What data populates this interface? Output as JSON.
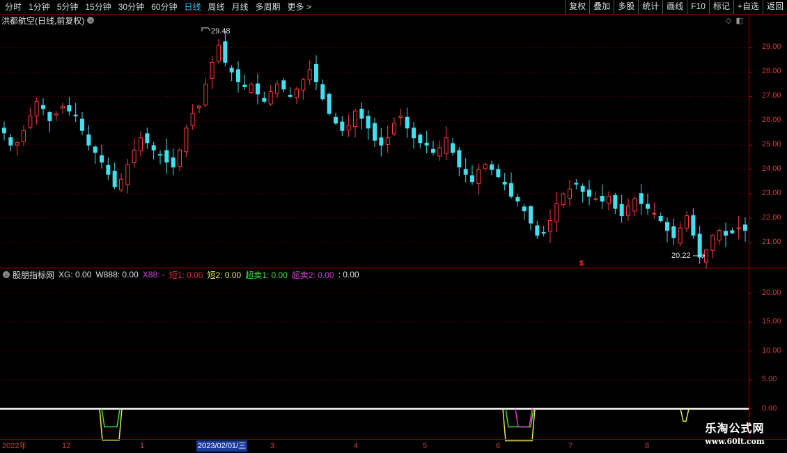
{
  "toolbar": {
    "periods": [
      "分时",
      "1分钟",
      "5分钟",
      "15分钟",
      "30分钟",
      "60分钟",
      "日线",
      "周线",
      "月线",
      "多周期",
      "更多 >"
    ],
    "active_period": "日线",
    "buttons": [
      "复权",
      "叠加",
      "多股",
      "统计",
      "画线",
      "F10",
      "标记",
      "+自选",
      "返回"
    ]
  },
  "chart_title": {
    "name": "洪都航空(日线,前复权)",
    "icon": "chevron-down-icon"
  },
  "price_axis": [
    "29.00",
    "28.00",
    "27.00",
    "26.00",
    "25.00",
    "24.00",
    "23.00",
    "22.00",
    "21.00"
  ],
  "annotations": {
    "high": "29.48",
    "low": "20.22",
    "marker": "$"
  },
  "indicator": {
    "name": "股朋指标网",
    "items": [
      {
        "label": "XG: 0.00",
        "color": "#e0e0e0"
      },
      {
        "label": "W888: 0.00",
        "color": "#e0e0e0"
      },
      {
        "label": "X88: -",
        "color": "#d040d0"
      },
      {
        "label": "短1: 0.00",
        "color": "#e03030"
      },
      {
        "label": "短2: 0.00",
        "color": "#e8e860"
      },
      {
        "label": "超卖1: 0.00",
        "color": "#40e040"
      },
      {
        "label": "超卖2: 0.00",
        "color": "#d040d0"
      },
      {
        "label": ": 0.00",
        "color": "#e0e0e0"
      }
    ]
  },
  "indicator_axis": [
    "20.00",
    "15.00",
    "10.00",
    "5.00",
    "0.00"
  ],
  "dates": [
    "2022年",
    "12",
    "1",
    "2023/02/01/三",
    "3",
    "4",
    "5",
    "6",
    "7",
    "8"
  ],
  "watermark": {
    "title": "乐淘公式网",
    "url": "www.60lt.com"
  },
  "colors": {
    "up": "#ff3c3c",
    "down": "#40e0f0",
    "grid": "#7a0000",
    "text_red": "#d04040"
  },
  "chart_data": {
    "type": "candlestick",
    "title": "洪都航空(日线,前复权)",
    "ylim": [
      20.0,
      29.9
    ],
    "high": 29.48,
    "low": 20.22,
    "closes": [
      25.5,
      25.0,
      25.1,
      25.6,
      26.2,
      26.8,
      26.5,
      26.0,
      26.3,
      26.6,
      26.4,
      26.2,
      25.6,
      25.0,
      24.7,
      24.3,
      23.8,
      23.3,
      23.6,
      24.2,
      24.8,
      25.3,
      25.1,
      24.8,
      24.6,
      24.3,
      24.1,
      24.8,
      25.7,
      26.3,
      26.6,
      27.5,
      28.4,
      29.1,
      28.4,
      28.0,
      27.6,
      27.4,
      27.5,
      27.1,
      26.8,
      27.2,
      27.5,
      27.3,
      27.0,
      27.3,
      27.7,
      28.1,
      27.6,
      26.9,
      26.3,
      25.9,
      25.6,
      25.8,
      26.4,
      26.1,
      25.7,
      25.2,
      25.0,
      25.3,
      25.9,
      26.2,
      25.7,
      25.3,
      25.1,
      25.0,
      24.7,
      24.9,
      25.3,
      24.7,
      24.1,
      23.8,
      23.5,
      24.0,
      24.2,
      24.0,
      23.7,
      23.4,
      22.9,
      22.7,
      22.3,
      21.8,
      21.3,
      21.4,
      21.9,
      22.6,
      23.0,
      23.2,
      23.4,
      23.1,
      22.9,
      22.8,
      22.7,
      22.9,
      22.4,
      22.1,
      22.5,
      22.8,
      22.6,
      22.4,
      22.2,
      21.9,
      21.5,
      21.2,
      21.6,
      22.1,
      21.3,
      20.4,
      20.7,
      21.3,
      21.5,
      21.3,
      21.4,
      21.6,
      21.5
    ],
    "indicator_ylim": [
      -5,
      22
    ]
  }
}
